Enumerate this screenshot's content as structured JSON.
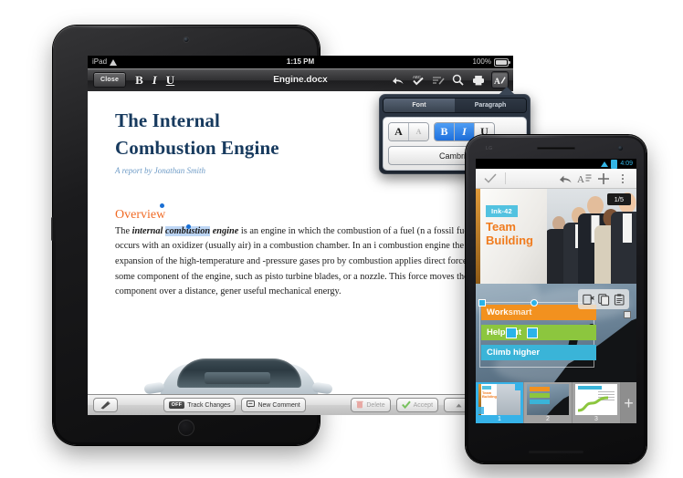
{
  "tablet": {
    "status_bar": {
      "carrier": "iPad",
      "wifi_icon": "wifi-icon",
      "time": "1:15 PM",
      "battery_percent": "100%",
      "battery_icon": "battery-icon"
    },
    "toolbar": {
      "close_label": "Close",
      "bold_label": "B",
      "italic_label": "I",
      "underline_label": "U",
      "document_title": "Engine.docx",
      "icons": [
        "undo-icon",
        "spellcheck-icon",
        "track-changes-icon",
        "search-icon",
        "print-icon",
        "format-icon"
      ]
    },
    "document": {
      "title_line1": "The Internal",
      "title_line2": "Combustion Engine",
      "byline": "A report by Jonathan Smith",
      "heading": "Overview",
      "body_before": "The ",
      "body_bold_italic_1": "internal ",
      "body_selected": "combustion",
      "body_bold_italic_2": " engine",
      "body_after": " is an engine in which the combustion of a fuel (n a fossil fuel) occurs with an oxidizer (usually air) in a combustion chamber. In an i combustion engine the expansion of the high-temperature and -pressure gases pro by combustion applies direct force to some component of the engine, such as pisto turbine blades, or a nozzle. This force moves the component over a distance, gener useful mechanical energy.",
      "image_caption": "car-photo"
    },
    "review_bar": {
      "pen_icon": "pen-icon",
      "track_changes_state": "OFF",
      "track_changes_label": "Track Changes",
      "new_comment_icon": "comment-icon",
      "new_comment_label": "New Comment",
      "delete_icon": "trash-icon",
      "delete_label": "Delete",
      "accept_icon": "check-icon",
      "accept_label": "Accept",
      "prev_icon": "caret-up-icon",
      "next_icon": "caret-down-icon"
    }
  },
  "popover": {
    "tabs": [
      {
        "label": "Font",
        "selected": true
      },
      {
        "label": "Paragraph",
        "selected": false
      }
    ],
    "font_size_increase": "A",
    "font_size_decrease": "A",
    "bold": "B",
    "italic": "I",
    "underline": "U",
    "bold_active": true,
    "italic_active": true,
    "underline_active": false,
    "font_name": "Cambria",
    "accent_color": "#2f82e8"
  },
  "phone": {
    "status_bar": {
      "wifi_icon": "wifi-icon",
      "battery_icon": "battery-icon",
      "time": "4:09"
    },
    "toolbar": {
      "done_icon": "check-icon",
      "undo_icon": "undo-icon",
      "text_format_icon": "text-format-icon",
      "add_icon": "plus-icon",
      "overflow_icon": "overflow-menu-icon"
    },
    "slide_current": {
      "badge": "Ink-42",
      "title_line1": "Team",
      "title_line2": "Building",
      "counter": "1/5",
      "badge_color": "#53c2e0",
      "title_color": "#f07c1f"
    },
    "slide_editing": {
      "text_boxes": [
        {
          "label_strong": "Work",
          "label_rest": " smart",
          "color": "#f2911f"
        },
        {
          "label_strong": "Hel",
          "label_rest": "p out",
          "color": "#8cc63e"
        },
        {
          "label_strong": "Climb higher",
          "label_rest": "",
          "color": "#3ab4d8"
        }
      ],
      "context_icons": [
        "cut-icon",
        "copy-icon",
        "paste-icon"
      ]
    },
    "thumbnails": [
      {
        "number": "1",
        "selected": true
      },
      {
        "number": "2",
        "selected": false
      },
      {
        "number": "3",
        "selected": false
      }
    ],
    "add_slide_label": "+"
  }
}
